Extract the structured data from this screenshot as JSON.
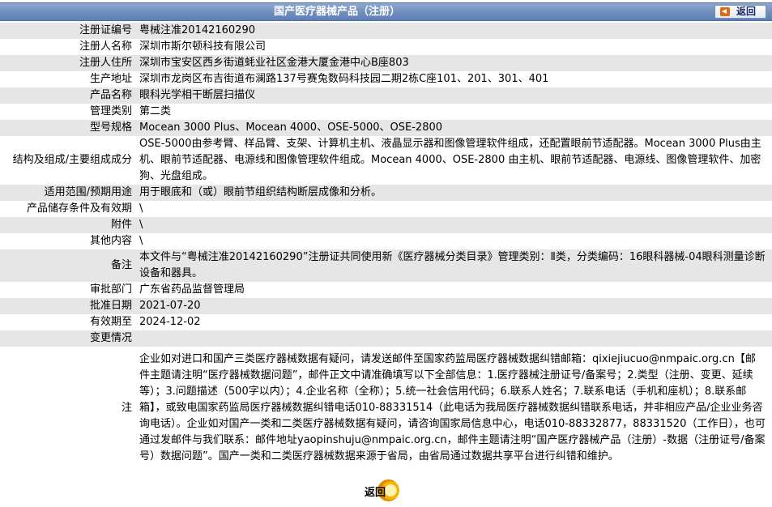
{
  "header": {
    "title": "国产医疗器械产品（注册）",
    "back_label": "返回"
  },
  "rows": [
    {
      "key": "注册证编号",
      "value": "粤械注准20142160290"
    },
    {
      "key": "注册人名称",
      "value": "深圳市斯尔顿科技有限公司"
    },
    {
      "key": "注册人住所",
      "value": "深圳市宝安区西乡街道蚝业社区金港大厦金港中心B座803"
    },
    {
      "key": "生产地址",
      "value": "深圳市龙岗区布吉街道布澜路137号赛兔数码科技园二期2栋C座101、201、301、401"
    },
    {
      "key": "产品名称",
      "value": "眼科光学相干断层扫描仪"
    },
    {
      "key": "管理类别",
      "value": "第二类"
    },
    {
      "key": "型号规格",
      "value": "Mocean 3000 Plus、Mocean 4000、OSE-5000、OSE-2800"
    },
    {
      "key": "结构及组成/主要组成成分",
      "value": "OSE-5000由参考臂、样品臂、支架、计算机主机、液晶显示器和图像管理软件组成，还配置眼前节适配器。Mocean 3000 Plus由主机、眼前节适配器、电源线和图像管理软件组成。Mocean 4000、OSE-2800 由主机、眼前节适配器、电源线、图像管理软件、加密狗、光盘组成。"
    },
    {
      "key": "适用范围/预期用途",
      "value": "用于眼底和（或）眼前节组织结构断层成像和分析。"
    },
    {
      "key": "产品储存条件及有效期",
      "value": "\\"
    },
    {
      "key": "附件",
      "value": "\\"
    },
    {
      "key": "其他内容",
      "value": "\\"
    },
    {
      "key": "备注",
      "value": "本文件与“粤械注准20142160290”注册证共同使用新《医疗器械分类目录》管理类别：Ⅱ类，分类编码：16眼科器械-04眼科测量诊断设备和器具。"
    },
    {
      "key": "审批部门",
      "value": "广东省药品监督管理局"
    },
    {
      "key": "批准日期",
      "value": "2021-07-20"
    },
    {
      "key": "有效期至",
      "value": "2024-12-02"
    },
    {
      "key": "变更情况",
      "value": ""
    }
  ],
  "note": {
    "key": "注",
    "text": "企业如对进口和国产三类医疗器械数据有疑问，请发送邮件至国家药监局医疗器械数据纠错邮箱：qixiejiucuo@nmpaic.org.cn【邮件主题请注明“医疗器械数据问题”，邮件正文中请准确填写以下全部信息：1.医疗器械注册证号/备案号；2.类型（注册、变更、延续等）；3.问题描述（500字以内）；4.企业名称（全称）；5.统一社会信用代码；6.联系人姓名；7.联系电话（手机和座机）；8.联系邮箱】，或致电国家药监局医疗器械数据纠错电话010-88331514（此电话为我局医疗器械数据纠错联系电话，并非相应产品/企业业务咨询电话）。企业如对国产一类和二类医疗器械数据有疑问，请咨询国家局信息中心，电话010-88332877，88331520（工作日），也可通过发邮件与我们联系：邮件地址yaopinshuju@nmpaic.org.cn，邮件主题请注明“国产医疗器械产品（注册）-数据（注册证号/备案号）数据问题”。国产一类和二类医疗器械数据来源于省局，由省局通过数据共享平台进行纠错和维护。"
  },
  "footer": {
    "back_label": "返回"
  }
}
